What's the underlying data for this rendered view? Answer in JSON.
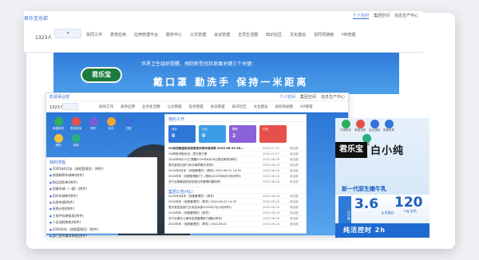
{
  "bg_header": {
    "brand": "君乐宝总部",
    "account_num": "1323人",
    "nav": [
      "协同工作",
      "表单应用",
      "应用管理平台",
      "服务中心",
      "公文管理",
      "会议管理",
      "全员生活圈",
      "知识社区",
      "文化建设",
      "协同驾驶舱",
      "HR管理"
    ],
    "user_tabs": [
      "个人空间",
      "集团空间",
      "信息生产中心"
    ]
  },
  "banner": {
    "logo": "君乐宝",
    "subtitle": "世界卫生组织提醒，预防新型冠状病毒关键三个关键：",
    "slogan": "戴口罩    勤洗手    保持一米距离"
  },
  "fg": {
    "brand": "奶源事业部",
    "account_num": "1323人",
    "nav": [
      "协同工作",
      "表单应用",
      "业务生活圈",
      "公文管理",
      "任务管理",
      "会议管理",
      "知识社区",
      "文化建设",
      "协同驾驶舱",
      "HR管理"
    ],
    "user_tabs": [
      "个人空间",
      "集团空间",
      "信息生产中心"
    ]
  },
  "apps": [
    {
      "label": "新建事项",
      "color": "#2fae5c"
    },
    {
      "label": "表单应用",
      "color": "#e6504a"
    },
    {
      "label": "知识",
      "color": "#7b5cd6"
    },
    {
      "label": "待办",
      "color": "#f0a43a"
    },
    {
      "label": "日程",
      "color": "#3a6fd8"
    },
    {
      "label": "我的",
      "color": "#f0c23a"
    },
    {
      "label": "添加",
      "color": "#27b07b"
    }
  ],
  "work": {
    "title": "我的工作",
    "cards": [
      {
        "label": "待办",
        "value": "0",
        "color": "#2f77d6"
      },
      {
        "label": "已办",
        "value": "0",
        "color": "#3a9de6"
      },
      {
        "label": "跟踪",
        "value": "2",
        "color": "#8a61d8"
      },
      {
        "label": "已发",
        "value": "",
        "color": "#e6504a"
      }
    ],
    "rows": [
      {
        "title": "OA系统集团新系统使用手册申请说明 2020-06-30 08:...",
        "date": "2020-07-12",
        "who": "综合部",
        "bold": true
      },
      {
        "title": "OA审批流程优化，提交更方便",
        "date": "2020-07-07",
        "who": "综合部",
        "bold": false
      },
      {
        "title": "2020年6月12日 提醒2020年6月18日报告事项(邮件)",
        "date": "2020-06-28",
        "who": "综合部",
        "bold": false
      },
      {
        "title": "君乐宝供应部门承办事项情况(附件)",
        "date": "2020-06-28",
        "who": "综合部",
        "bold": false
      },
      {
        "title": "2020年6月份（流程管理员）(物料) 2020-06-01 14:35",
        "date": "2020-06-28",
        "who": "综合部",
        "bold": false
      },
      {
        "title": "2020年年（流程管理部门）(物料)2020年6月计划(附件)",
        "date": "2020-06-28",
        "who": "综合部",
        "bold": false
      },
      {
        "title": "关于近期集团总部总部业务管理问题说明",
        "date": "2020-06-28",
        "who": "综合部",
        "bold": false
      }
    ],
    "notice_title": "集团公告(41)",
    "notice_rows": [
      {
        "title": "2020年6月份（流程管理员）(附件)",
        "date": "2020-06-28",
        "who": "综合部"
      },
      {
        "title": "2020年年（流程管理员）(附件) 2020-06-01 14:35",
        "date": "2020-06-28",
        "who": "综合部"
      },
      {
        "title": "君乐宝信息部门业务技术部2020年7月计划(附件)",
        "date": "2020-06-28",
        "who": "综合部"
      },
      {
        "title": "2020年年（流程管理员）(附件)",
        "date": "2020-06-28",
        "who": "综合部"
      },
      {
        "title": "关于近期办公事务信息管理部门通知(附件)",
        "date": "2020-06-28",
        "who": "综合部"
      },
      {
        "title": "2020年年（流程管理员）(附件) 2020-06-01",
        "date": "2020-06-28",
        "who": "综合部"
      }
    ]
  },
  "sidebar_list": {
    "title": "我的流程",
    "items": [
      "2020年6月份（流程管理员）(附件)",
      "快递邮寄申请单(附件)",
      "物品领用单(附件)",
      "用章申请（一般）(附件)",
      "用车申请单(附件)",
      "出差申请(附件)",
      "采购计划(附件)",
      "工程中标审批表(附件)",
      "人员流程审批(附件)",
      "2020年年（流程管理员）(附件)",
      "部门宣传事务审批(附件)"
    ]
  },
  "ad": {
    "app_labels": [
      "日程助手",
      "新建流程",
      "会议通知",
      "新建表单",
      "新增"
    ],
    "app_colors": [
      "#2fae5c",
      "#e6504a",
      "#3a6fd8",
      "#2f77d6",
      "#27b07b"
    ],
    "logo": "君乐宝",
    "name": "白小纯",
    "tagline": "新一代原生嫩牛乳",
    "protein": "3.6",
    "protein_unit": "g 乳蛋白",
    "freshness": "120",
    "freshness_unit": "mg 乳钙",
    "carton": "白小纯",
    "bottom": "纯活控时 2h"
  }
}
